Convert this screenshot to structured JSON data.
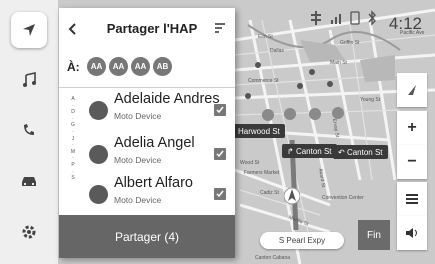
{
  "nav": {
    "items": [
      "navigation-icon",
      "music-icon",
      "phone-icon",
      "car-icon",
      "settings-icon"
    ],
    "active": 0
  },
  "panel": {
    "title": "Partager l'HAP",
    "to_label": "À:",
    "recipients": [
      "AA",
      "AA",
      "AA",
      "AB"
    ],
    "alpha_index": [
      "A",
      "·",
      "D",
      "·",
      "G",
      "·",
      "J",
      "·",
      "M",
      "·",
      "P",
      "·",
      "S"
    ],
    "contacts": [
      {
        "name": "Adelaide Andres",
        "device": "Moto Device",
        "checked": true
      },
      {
        "name": "Adelia Angel",
        "device": "Moto Device",
        "checked": true
      },
      {
        "name": "Albert Alfaro",
        "device": "Moto Device",
        "checked": true
      }
    ],
    "share_label": "Partager (4)"
  },
  "status": {
    "time": "4:12"
  },
  "map": {
    "streets": [
      "Harwood St",
      "Canton St",
      "Canton St"
    ],
    "labels": [
      "Elm St",
      "Commerce St",
      "Main St",
      "Cadiz St",
      "Marilla St",
      "Akard St",
      "Griffin St",
      "Young St",
      "Wood St",
      "Ervay St",
      "Pacific Ave",
      "Farmers Market",
      "Convention Center",
      "Canton Cabana",
      "Dallas"
    ],
    "pearl_label": "S Pearl Expy",
    "fin_label": "Fin"
  },
  "controls": [
    "compass-icon",
    "zoom-in-icon",
    "zoom-out-icon",
    "menu-icon",
    "sound-icon"
  ],
  "colors": {
    "panel_button": "#666666",
    "nav_bg": "#efefef",
    "map_bg": "#c9c9c9"
  }
}
